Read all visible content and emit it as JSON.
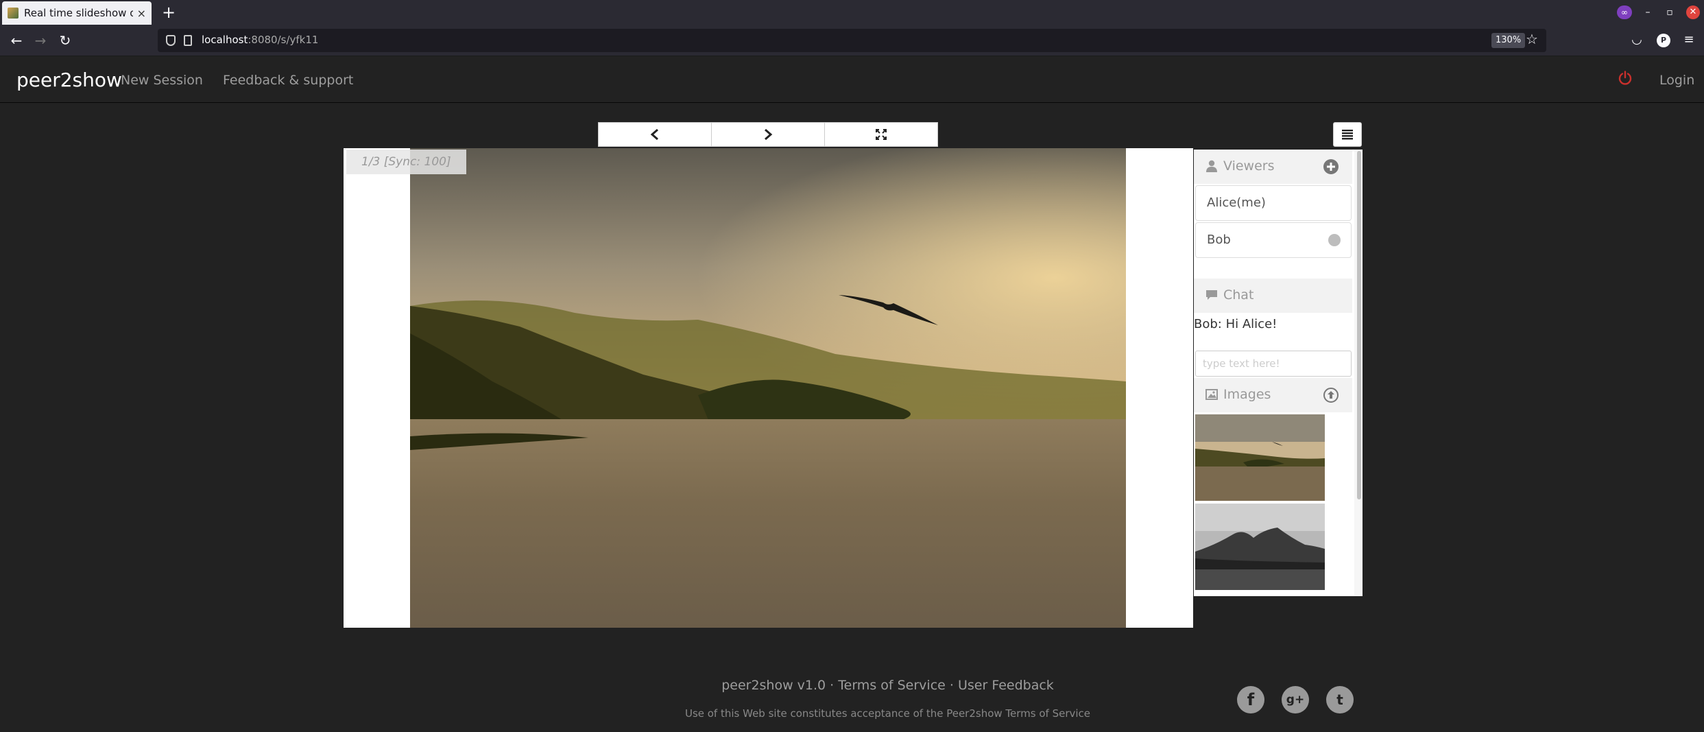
{
  "browser": {
    "tab_title": "Real time slideshow onlin",
    "tab_close": "×",
    "new_tab": "+",
    "url_host": "localhost",
    "url_rest": ":8080/s/yfk11",
    "zoom": "130%",
    "window_controls": {
      "minimize": "–",
      "maximize": "▫",
      "close": "✕"
    }
  },
  "app_nav": {
    "brand": "peer2show",
    "links": [
      "New Session",
      "Feedback & support"
    ],
    "login": "Login",
    "colors": {
      "power": "#c9302c"
    }
  },
  "slide": {
    "sync_label": "1/3 [Sync: 100]"
  },
  "sidebar": {
    "viewers_heading": "Viewers",
    "viewers": [
      "Alice(me)",
      "Bob"
    ],
    "chat_heading": "Chat",
    "chat_messages": [
      {
        "author": "Bob:",
        "text": "Hi Alice!"
      }
    ],
    "chat_placeholder": "type text here!",
    "images_heading": "Images"
  },
  "footer": {
    "version": "peer2show v1.0",
    "separator": " · ",
    "terms": "Terms of Service",
    "feedback": "User Feedback",
    "note": "Use of this Web site constitutes acceptance of the Peer2show Terms of Service",
    "social": [
      "f",
      "g+",
      "t"
    ]
  },
  "icons": {
    "prev": "chevron-left-icon",
    "next": "chevron-right-icon",
    "fullscreen": "expand-icon",
    "menu": "list-icon",
    "viewers": "user-icon",
    "add_viewer": "plus-circle-icon",
    "chat": "comment-icon",
    "images": "picture-icon",
    "upload": "upload-circle-icon"
  }
}
